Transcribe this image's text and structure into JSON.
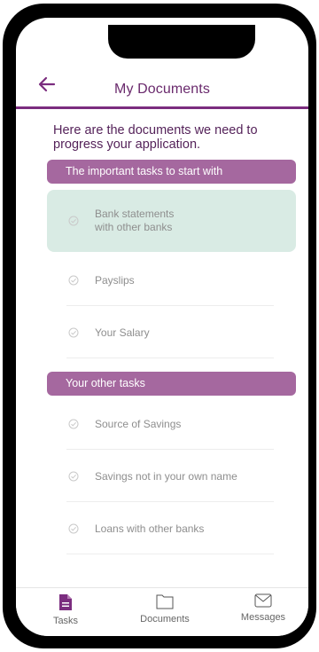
{
  "header": {
    "title": "My Documents",
    "back_icon": "arrow-left-icon"
  },
  "intro": "Here are the documents we need to progress your application.",
  "sections": [
    {
      "title": "The important tasks to start with",
      "tasks": [
        "Bank statements\nwith other banks",
        "Payslips",
        "Your Salary"
      ]
    },
    {
      "title": "Your other tasks",
      "tasks": [
        "Source of Savings",
        "Savings not in your own name",
        "Loans with other banks"
      ]
    }
  ],
  "tabs": [
    {
      "label": "Tasks",
      "icon": "document-icon"
    },
    {
      "label": "Documents",
      "icon": "folder-icon"
    },
    {
      "label": "Messages",
      "icon": "envelope-icon"
    }
  ],
  "colors": {
    "accent": "#7b2d7f",
    "section_bar": "#a5689f",
    "active_task": "#d9ebe4"
  }
}
